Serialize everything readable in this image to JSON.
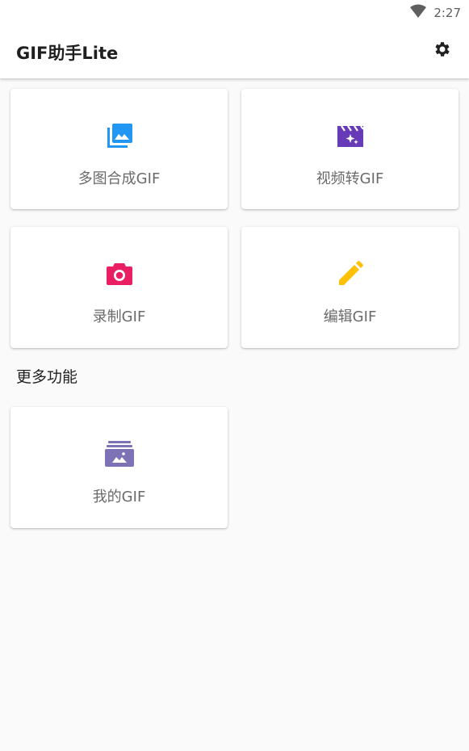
{
  "status_bar": {
    "time": "2:27",
    "icons": [
      "wifi-icon"
    ]
  },
  "app_bar": {
    "title": "GIF助手Lite",
    "settings_icon": "gear-icon"
  },
  "main_cards": [
    {
      "label": "多图合成GIF",
      "icon": "photo-library-icon",
      "color": "#2196f3"
    },
    {
      "label": "视频转GIF",
      "icon": "movie-filter-icon",
      "color": "#673ab7"
    },
    {
      "label": "录制GIF",
      "icon": "camera-icon",
      "color": "#e91e63"
    },
    {
      "label": "编辑GIF",
      "icon": "edit-pencil-icon",
      "color": "#ffc107"
    }
  ],
  "more_section": {
    "title": "更多功能",
    "cards": [
      {
        "label": "我的GIF",
        "icon": "photo-album-icon",
        "color": "#7e72b6"
      }
    ]
  },
  "colors": {
    "background": "#fafafa",
    "card": "#ffffff",
    "label_text": "#6a6a6a"
  }
}
